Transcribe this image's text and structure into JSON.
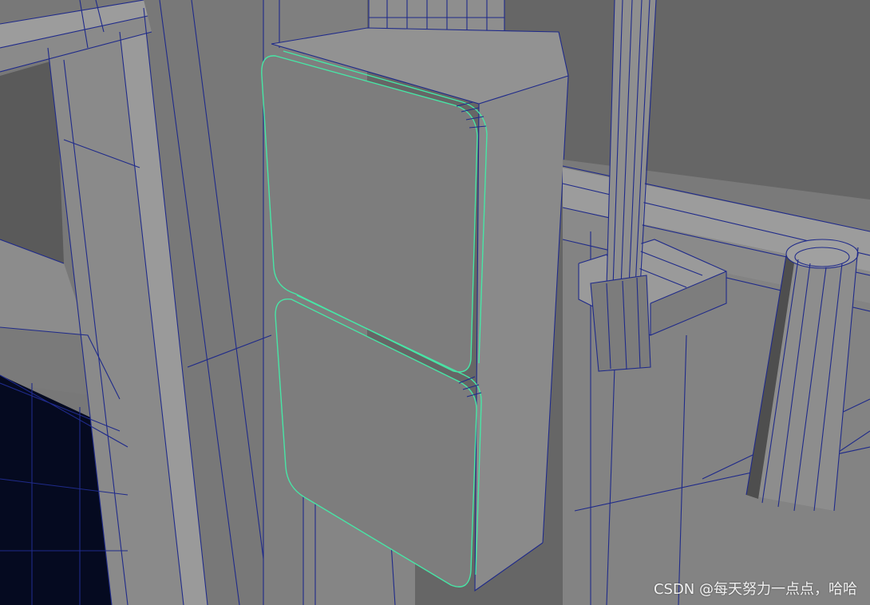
{
  "scene": {
    "background": "#686868",
    "wire_color": "#1f2a8a",
    "selection_color": "#47e6a6"
  },
  "watermark": {
    "text": "CSDN @每天努力一点点，哈哈"
  }
}
